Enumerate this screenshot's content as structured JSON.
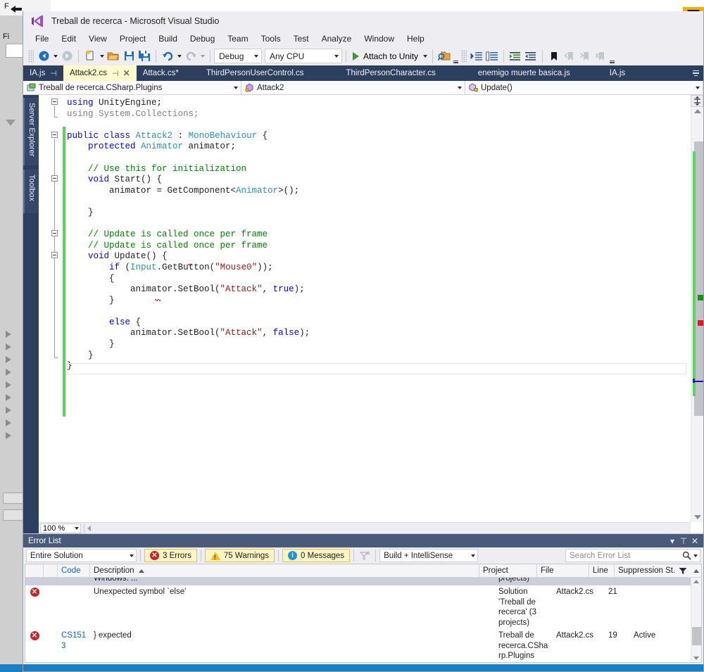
{
  "background_window": {
    "title_fragment": "F",
    "menu_fragment": "Fi"
  },
  "window": {
    "title": "Treball de recerca - Microsoft Visual Studio",
    "logo_icon": "visual-studio-logo"
  },
  "menubar": {
    "items": [
      "File",
      "Edit",
      "View",
      "Project",
      "Build",
      "Debug",
      "Team",
      "Tools",
      "Test",
      "Analyze",
      "Window",
      "Help"
    ]
  },
  "toolbar": {
    "nav_back_icon": "navigate-back-icon",
    "nav_forward_icon": "navigate-forward-icon",
    "new_item_icon": "new-item-icon",
    "open_file_icon": "open-file-icon",
    "save_icon": "save-icon",
    "save_all_icon": "save-all-icon",
    "undo_icon": "undo-icon",
    "redo_icon": "redo-icon",
    "config_value": "Debug",
    "platform_value": "Any CPU",
    "run_label": "Attach to Unity",
    "run_icon": "play-icon",
    "find_icon": "find-in-files-icon",
    "comment_icon": "comment-selection-icon",
    "uncomment_icon": "uncomment-selection-icon",
    "indent_icon": "increase-indent-icon",
    "outdent_icon": "decrease-indent-icon",
    "bookmark_icon": "bookmark-icon",
    "prev_bookmark_icon": "previous-bookmark-icon",
    "next_bookmark_icon": "next-bookmark-icon",
    "clear_bookmarks_icon": "clear-bookmarks-icon",
    "overflow_icon": "toolbar-overflow-icon"
  },
  "tabs": {
    "items": [
      {
        "label": "IA.js",
        "active": false,
        "pinned": true,
        "modified": false,
        "closable": false
      },
      {
        "label": "Attack2.cs",
        "active": true,
        "pinned": true,
        "modified": false,
        "closable": true
      },
      {
        "label": "Attack.cs*",
        "active": false,
        "pinned": false,
        "modified": true,
        "closable": false
      },
      {
        "label": "ThirdPersonUserControl.cs",
        "active": false,
        "pinned": false,
        "modified": false,
        "closable": false
      },
      {
        "label": "ThirdPersonCharacter.cs",
        "active": false,
        "pinned": false,
        "modified": false,
        "closable": false
      },
      {
        "label": "enemigo muerte basica.js",
        "active": false,
        "pinned": false,
        "modified": false,
        "closable": false
      },
      {
        "label": "IA.js",
        "active": false,
        "pinned": false,
        "modified": false,
        "closable": false
      }
    ],
    "pin_glyph": "⊣",
    "close_glyph": "✕",
    "overflow_icon": "tab-overflow-icon"
  },
  "navbar": {
    "project": "Treball de recerca.CSharp.Plugins",
    "project_icon": "project-icon",
    "type": "Attack2",
    "type_icon": "class-icon",
    "member": "Update()",
    "member_icon": "method-private-icon",
    "caret_glyph": "▾"
  },
  "docked_tabs": {
    "server_explorer": "Server Explorer",
    "toolbox": "Toolbox"
  },
  "editor": {
    "zoom": "100 %",
    "zoom_caret": "▾",
    "split_icon": "split-view-icon",
    "scroll_up_icon": "scroll-up-icon",
    "scroll_down_icon": "scroll-down-icon",
    "code_lines": [
      [
        {
          "t": "using ",
          "c": "kw"
        },
        {
          "t": "UnityEngine;",
          "c": "plain"
        }
      ],
      [
        {
          "t": "using ",
          "c": "dim"
        },
        {
          "t": "System.Collections;",
          "c": "dim"
        }
      ],
      [],
      [
        {
          "t": "public class ",
          "c": "kw"
        },
        {
          "t": "Attack2",
          "c": "type"
        },
        {
          "t": " : ",
          "c": "plain"
        },
        {
          "t": "MonoBehaviour",
          "c": "type"
        },
        {
          "t": " {",
          "c": "plain"
        }
      ],
      [
        {
          "t": "    protected ",
          "c": "kw"
        },
        {
          "t": "Animator",
          "c": "type"
        },
        {
          "t": " animator;",
          "c": "plain"
        }
      ],
      [],
      [
        {
          "t": "    // Use this for initialization",
          "c": "cmt"
        }
      ],
      [
        {
          "t": "    ",
          "c": "plain"
        },
        {
          "t": "void ",
          "c": "kw"
        },
        {
          "t": "Start() {",
          "c": "plain"
        }
      ],
      [
        {
          "t": "        animator = GetComponent<",
          "c": "plain"
        },
        {
          "t": "Animator",
          "c": "type"
        },
        {
          "t": ">();",
          "c": "plain"
        }
      ],
      [],
      [
        {
          "t": "    }",
          "c": "plain"
        }
      ],
      [],
      [
        {
          "t": "    // Update is called once per frame",
          "c": "cmt"
        }
      ],
      [
        {
          "t": "    // Update is called once per frame",
          "c": "cmt"
        }
      ],
      [
        {
          "t": "    ",
          "c": "plain"
        },
        {
          "t": "void ",
          "c": "kw"
        },
        {
          "t": "Update() {",
          "c": "plain"
        }
      ],
      [
        {
          "t": "        ",
          "c": "plain"
        },
        {
          "t": "if ",
          "c": "kw"
        },
        {
          "t": "(",
          "c": "plain"
        },
        {
          "t": "Input",
          "c": "type"
        },
        {
          "t": ".GetButton(",
          "c": "plain"
        },
        {
          "t": "\"Mouse0\"",
          "c": "str"
        },
        {
          "t": "));",
          "c": "plain"
        }
      ],
      [
        {
          "t": "        {",
          "c": "plain"
        }
      ],
      [
        {
          "t": "            animator.SetBool(",
          "c": "plain"
        },
        {
          "t": "\"Attack\"",
          "c": "str"
        },
        {
          "t": ", ",
          "c": "plain"
        },
        {
          "t": "true",
          "c": "kw"
        },
        {
          "t": ");",
          "c": "plain"
        }
      ],
      [
        {
          "t": "        }",
          "c": "plain"
        }
      ],
      [],
      [
        {
          "t": "        ",
          "c": "plain"
        },
        {
          "t": "else ",
          "c": "kw"
        },
        {
          "t": "{",
          "c": "plain"
        }
      ],
      [
        {
          "t": "            animator.SetBool(",
          "c": "plain"
        },
        {
          "t": "\"Attack\"",
          "c": "str"
        },
        {
          "t": ", ",
          "c": "plain"
        },
        {
          "t": "false",
          "c": "kw"
        },
        {
          "t": ");",
          "c": "plain"
        }
      ],
      [
        {
          "t": "        }",
          "c": "plain"
        }
      ],
      [
        {
          "t": "    }",
          "c": "plain"
        }
      ],
      [
        {
          "t": "}",
          "c": "plain"
        }
      ]
    ]
  },
  "error_list": {
    "panel_title": "Error List",
    "menu_glyph": "▾",
    "pin_glyph": "⊤",
    "close_glyph": "✕",
    "scope_value": "Entire Solution",
    "errors_count": "3 Errors",
    "warnings_count": "75 Warnings",
    "messages_count": "0 Messages",
    "filter_icon": "clear-filter-icon",
    "build_filter_value": "Build + IntelliSense",
    "search_placeholder": "Search Error List",
    "search_icon": "search-icon",
    "search_caret": "▾",
    "columns": [
      "",
      "",
      "Code",
      "Description",
      "Project",
      "File",
      "Line",
      "Suppression St..."
    ],
    "sort_column": "Description",
    "sort_direction": "asc",
    "header_filter_icon": "column-filter-icon",
    "rows": [
      {
        "severity": "",
        "severity_icon": "",
        "code": "",
        "description": "Windows. ...",
        "project": "projects)",
        "file": "",
        "line": "",
        "suppression": "",
        "selected": true,
        "partial": true
      },
      {
        "severity": "error",
        "severity_icon": "error-icon",
        "code": "",
        "description": "Unexpected symbol `else'",
        "project": "Solution 'Treball de recerca' (3 projects)",
        "file": "Attack2.cs",
        "line": "21",
        "suppression": "",
        "selected": false,
        "partial": false
      },
      {
        "severity": "error",
        "severity_icon": "error-icon",
        "code": "CS1513",
        "description": "} expected",
        "project": "Treball de recerca.CSharp.Plugins",
        "file": "Attack2.cs",
        "line": "19",
        "suppression": "Active",
        "selected": false,
        "partial": false
      }
    ]
  },
  "colors": {
    "accent_blue": "#1b7fc4",
    "titlebar": "#eeeef2",
    "tabstrip": "#2d3f5f",
    "active_tab": "#fffbcc",
    "error_red": "#d32020",
    "warning_yellow": "#f3c01c",
    "info_blue": "#1b96d8",
    "change_green": "#57d657",
    "panel_header": "#4a5a7b"
  }
}
